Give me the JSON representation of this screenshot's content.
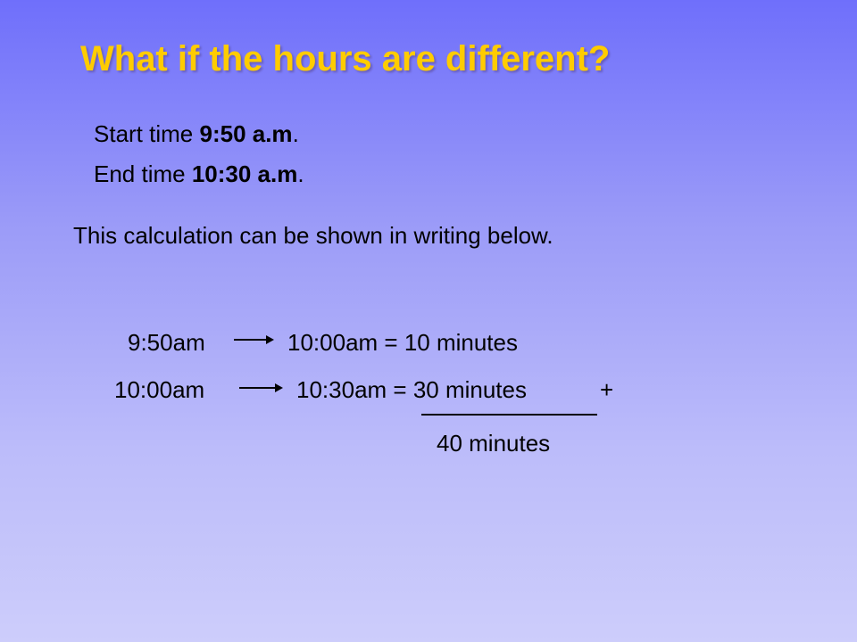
{
  "title": "What if the hours are different?",
  "times": {
    "start_prefix": "Start time ",
    "start_value": "9:50 a.m",
    "start_suffix": ".",
    "end_prefix": "End time ",
    "end_value": "10:30 a.m",
    "end_suffix": "."
  },
  "note": "This calculation can be shown in writing below.",
  "calculation": {
    "row1_from": "9:50am",
    "row1_result": "10:00am = 10 minutes",
    "row2_from": "10:00am",
    "row2_result": "10:30am = 30 minutes",
    "plus_sign": "+",
    "total": "40 minutes"
  },
  "colors": {
    "title": "#ffcc00",
    "background_top": "#6f6ffb",
    "background_bottom": "#cdcdfb"
  }
}
